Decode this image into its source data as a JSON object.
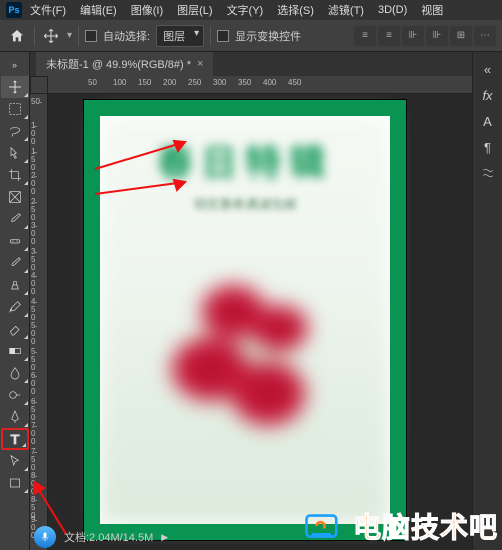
{
  "menu": {
    "items": [
      "文件(F)",
      "编辑(E)",
      "图像(I)",
      "图层(L)",
      "文字(Y)",
      "选择(S)",
      "滤镜(T)",
      "3D(D)",
      "视图"
    ]
  },
  "options": {
    "auto_select_label": "自动选择:",
    "select_target": "图层",
    "show_transform_label": "显示变换控件"
  },
  "tab": {
    "title": "未标题-1 @ 49.9%(RGB/8#) *"
  },
  "ruler_h": [
    "50",
    "100",
    "150",
    "200",
    "250",
    "300",
    "350",
    "400",
    "450"
  ],
  "ruler_v": [
    "50",
    "100",
    "150",
    "200",
    "250",
    "300",
    "350",
    "400",
    "450",
    "500",
    "550",
    "600",
    "650",
    "700",
    "750",
    "800",
    "850",
    "900"
  ],
  "canvas": {
    "title_blurred": "春日特辑",
    "subtitle_blurred": "领优惠券满减包邮"
  },
  "status": {
    "doc_size": "文档:2.04M/14.5M"
  },
  "right_icons": [
    "fx",
    "A",
    "¶",
    "switch"
  ],
  "watermark": {
    "text": "电脑技术吧"
  }
}
